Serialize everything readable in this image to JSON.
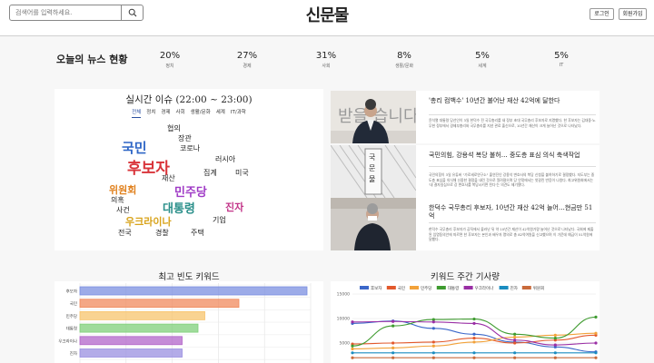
{
  "header": {
    "search_placeholder": "검색어를 입력하세요.",
    "logo": "신문물",
    "login_label": "로그인",
    "signup_label": "회원가입"
  },
  "stats": {
    "title": "오늘의 뉴스 현황",
    "items": [
      {
        "value": "20%",
        "label": "정치"
      },
      {
        "value": "27%",
        "label": "경제"
      },
      {
        "value": "31%",
        "label": "사회"
      },
      {
        "value": "8%",
        "label": "생활/문화"
      },
      {
        "value": "5%",
        "label": "세계"
      },
      {
        "value": "5%",
        "label": "IT"
      }
    ]
  },
  "realtime": {
    "title": "실시간 이슈 (22:00 ~ 23:00)",
    "tabs": [
      "전체",
      "정치",
      "경제",
      "사회",
      "생활/문화",
      "세계",
      "IT/과학"
    ],
    "active_tab": "전체",
    "keywords": [
      "협의",
      "장관",
      "국민",
      "코로나",
      "후보자",
      "러시아",
      "재산",
      "집계",
      "미국",
      "위원회",
      "민주당",
      "의혹",
      "진자",
      "사건",
      "대통령",
      "우크라이나",
      "기업",
      "전국",
      "경찰",
      "주택"
    ]
  },
  "news": [
    {
      "headline": "'총리 컴백수' 10년간 불어난 재산 42억에 달한다",
      "summary": "윤석열 대통령 당선인이 3일 한덕수 전 국무총리를 새 정부 초대 국무총리 후보자로 지명했다. 한 후보자는 김대중·노무현 정부에서 경제부총리와 국무총리를 지낸 관료 출신으로, 10년간 재산이 크게 늘어난 것으로 나타났다."
    },
    {
      "headline": "국민의힘, 강용석 복당 불허… 중도층 표심 의식 축색작업",
      "summary": "국민의힘이 3일 유튜버 \"가로세로연구소\" 출연진인 강용석 변호사의 복당 신청을 불허하기로 결정했다. 지도부는 중도층 표심을 의식해 신중한 결정을 내린 것으로 알려졌으며 당 안팎에서는 엇갈린 반응이 나왔다. 최고위원회에서는 '내 결자일심으로 강 변호사를 복당시키면 된다'는 의견도 제기됐다."
    },
    {
      "headline": "한덕수 국무총리 후보자, 10년간 재산 42억 늘어…현금만 51억",
      "summary": "한덕수 국무총리 후보자가 공직에서 물러난 뒤 약 10년간 재산이 42억원가량 늘어난 것으로 나타났다. 국회에 제출된 임명동의안에 따르면 한 후보자는 본인과 배우자 명의로 총 82억여원을 신고했으며 이 가운데 예금이 51억원에 달했다."
    }
  ],
  "freq_chart_title": "최고 빈도 키워드",
  "trend_chart_title": "키워드 주간 기사량",
  "chart_data": [
    {
      "type": "bar",
      "orientation": "horizontal",
      "title": "최고 빈도 키워드",
      "categories": [
        "후보자",
        "국민",
        "민주당",
        "대통령",
        "우크라이나",
        "진자"
      ],
      "values": [
        100,
        70,
        55,
        52,
        45,
        45
      ],
      "colors": [
        "#7b8fe0",
        "#f08a5d",
        "#f7c46c",
        "#7fcf7a",
        "#b264c9",
        "#9a8fe0"
      ],
      "grid": true
    },
    {
      "type": "line",
      "title": "키워드 주간 기사량",
      "ylim": [
        0,
        15000
      ],
      "yticks": [
        5000,
        10000,
        15000
      ],
      "legend_position": "top",
      "series": [
        {
          "name": "후보자",
          "color": "#3b67c9",
          "values": [
            9000,
            9500,
            8000,
            6800,
            5200,
            4200,
            3200
          ]
        },
        {
          "name": "국민",
          "color": "#e2582b",
          "values": [
            4800,
            5000,
            5200,
            6000,
            5000,
            5600,
            6600
          ]
        },
        {
          "name": "민주당",
          "color": "#f2a23a",
          "values": [
            3800,
            4000,
            4400,
            5200,
            6200,
            6600,
            7000
          ]
        },
        {
          "name": "대통령",
          "color": "#3e9b2f",
          "values": [
            4400,
            8500,
            9800,
            9900,
            6800,
            6000,
            10300
          ]
        },
        {
          "name": "우크라이나",
          "color": "#9a2fa5",
          "values": [
            9300,
            9400,
            9300,
            9000,
            5600,
            4600,
            5000
          ]
        },
        {
          "name": "진자",
          "color": "#1a8cc0",
          "values": [
            3000,
            3000,
            3000,
            3000,
            3000,
            3000,
            3000
          ]
        },
        {
          "name": "위원회",
          "color": "#c96a3b",
          "values": [
            2000,
            2000,
            2000,
            2000,
            2000,
            2000,
            2000
          ]
        }
      ]
    }
  ]
}
